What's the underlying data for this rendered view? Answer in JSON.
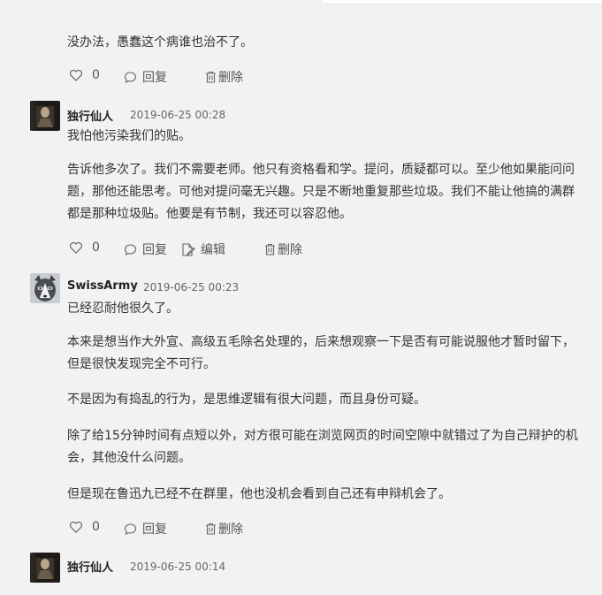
{
  "comments": [
    {
      "paragraphs": [
        [
          "没办法，愚蠢这个病谁也治不了。"
        ]
      ],
      "actions": {
        "likes": "0",
        "reply": "回复",
        "delete": "删除"
      }
    },
    {
      "author": "独行仙人",
      "time": "2019-06-25 00:28",
      "avatar_icon": "dark-portrait-avatar",
      "paragraphs": [
        [
          "我怕他污染我们的贴。"
        ],
        [
          "告诉他多次了。我们不需要老师。他只有资格看和学。提问，质疑都可以。至少他如果能问问",
          "题，那他还能思考。可他对提问毫无兴趣。只是不断地重复那些垃圾。我们不能让他搞的满群",
          "都是那种垃圾贴。他要是有节制，我还可以容忍他。"
        ]
      ],
      "actions": {
        "likes": "0",
        "reply": "回复",
        "edit": "编辑",
        "delete": "删除"
      }
    },
    {
      "author": "SwissArmy",
      "time": "2019-06-25 00:23",
      "avatar_icon": "husky-dog-avatar",
      "paragraphs": [
        [
          "已经忍耐他很久了。"
        ],
        [
          "本来是想当作大外宣、高级五毛除名处理的，后来想观察一下是否有可能说服他才暂时留下，",
          "但是很快发现完全不可行。"
        ],
        [
          "不是因为有捣乱的行为，是思维逻辑有很大问题，而且身份可疑。"
        ],
        [
          "除了给15分钟时间有点短以外，对方很可能在浏览网页的时间空隙中就错过了为自己辩护的机",
          "会，其他没什么问题。"
        ],
        [
          "但是现在鲁迅九已经不在群里，他也没机会看到自己还有申辩机会了。"
        ]
      ],
      "actions": {
        "likes": "0",
        "reply": "回复",
        "delete": "删除"
      }
    },
    {
      "author": "独行仙人",
      "time": "2019-06-25 00:14",
      "avatar_icon": "dark-portrait-avatar"
    }
  ],
  "colors": {
    "page_bg": "#f2f2f2",
    "text": "#333333",
    "meta": "#666666"
  }
}
